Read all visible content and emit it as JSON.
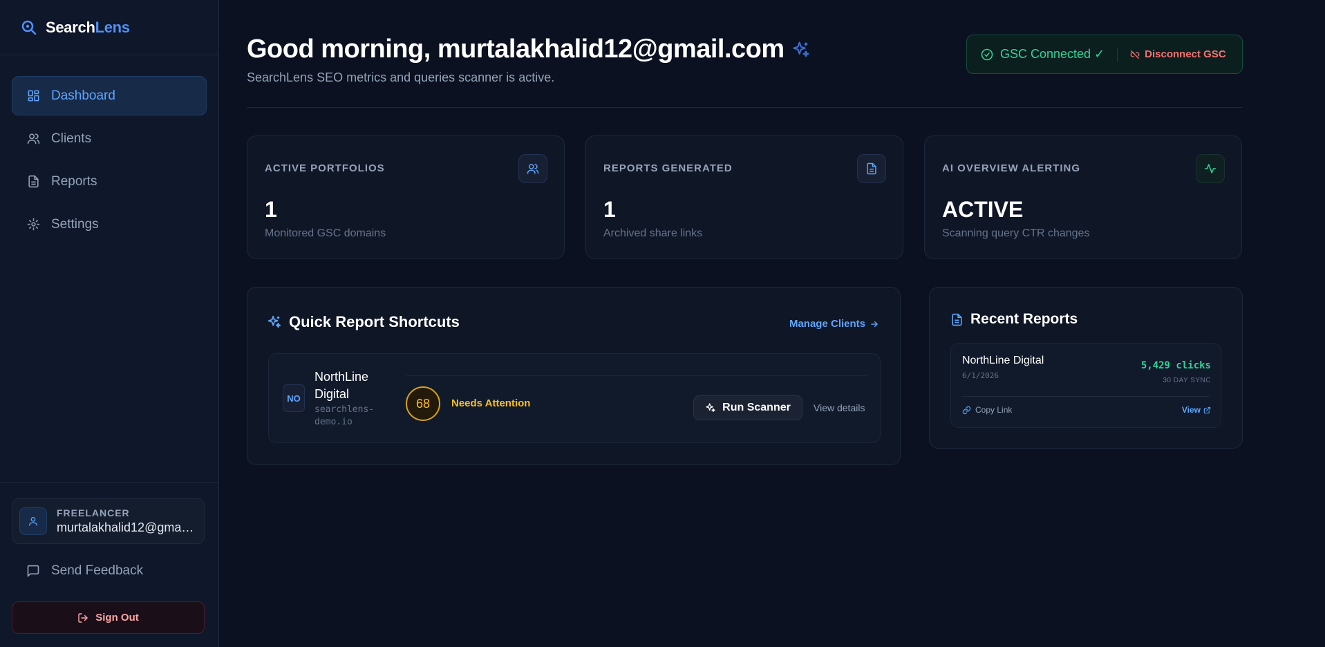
{
  "brand": {
    "name_part1": "Search",
    "name_part2": "Lens"
  },
  "sidebar": {
    "items": [
      {
        "label": "Dashboard",
        "icon": "dashboard-icon",
        "active": true
      },
      {
        "label": "Clients",
        "icon": "users-icon"
      },
      {
        "label": "Reports",
        "icon": "document-icon"
      },
      {
        "label": "Settings",
        "icon": "gear-icon"
      }
    ],
    "user": {
      "role": "FREELANCER",
      "email": "murtalakhalid12@gmail.com"
    },
    "feedback_label": "Send Feedback",
    "signout_label": "Sign Out"
  },
  "header": {
    "greeting": "Good morning, murtalakhalid12@gmail.com",
    "subtitle": "SearchLens SEO metrics and queries scanner is active.",
    "gsc_status": "GSC Connected ✓",
    "gsc_disconnect": "Disconnect GSC"
  },
  "stats": [
    {
      "label": "ACTIVE PORTFOLIOS",
      "value": "1",
      "desc": "Monitored GSC domains",
      "icon": "users-icon"
    },
    {
      "label": "REPORTS GENERATED",
      "value": "1",
      "desc": "Archived share links",
      "icon": "document-icon"
    },
    {
      "label": "AI OVERVIEW ALERTING",
      "value": "ACTIVE",
      "desc": "Scanning query CTR changes",
      "icon": "activity-icon"
    }
  ],
  "shortcuts": {
    "title": "Quick Report Shortcuts",
    "manage_label": "Manage Clients",
    "client": {
      "initials": "NO",
      "name": "NorthLine Digital",
      "domain": "searchlens-demo.io",
      "score": "68",
      "status": "Needs Attention",
      "run_label": "Run Scanner",
      "details_label": "View details"
    }
  },
  "recent_reports": {
    "title": "Recent Reports",
    "items": [
      {
        "name": "NorthLine Digital",
        "date": "6/1/2026",
        "clicks": "5,429 clicks",
        "sync": "30 DAY SYNC",
        "copy_label": "Copy Link",
        "view_label": "View"
      }
    ]
  },
  "colors": {
    "accent": "#60a5fa",
    "success": "#34d399",
    "warning": "#fbbf24",
    "danger": "#f87171",
    "background": "#0b1120"
  }
}
